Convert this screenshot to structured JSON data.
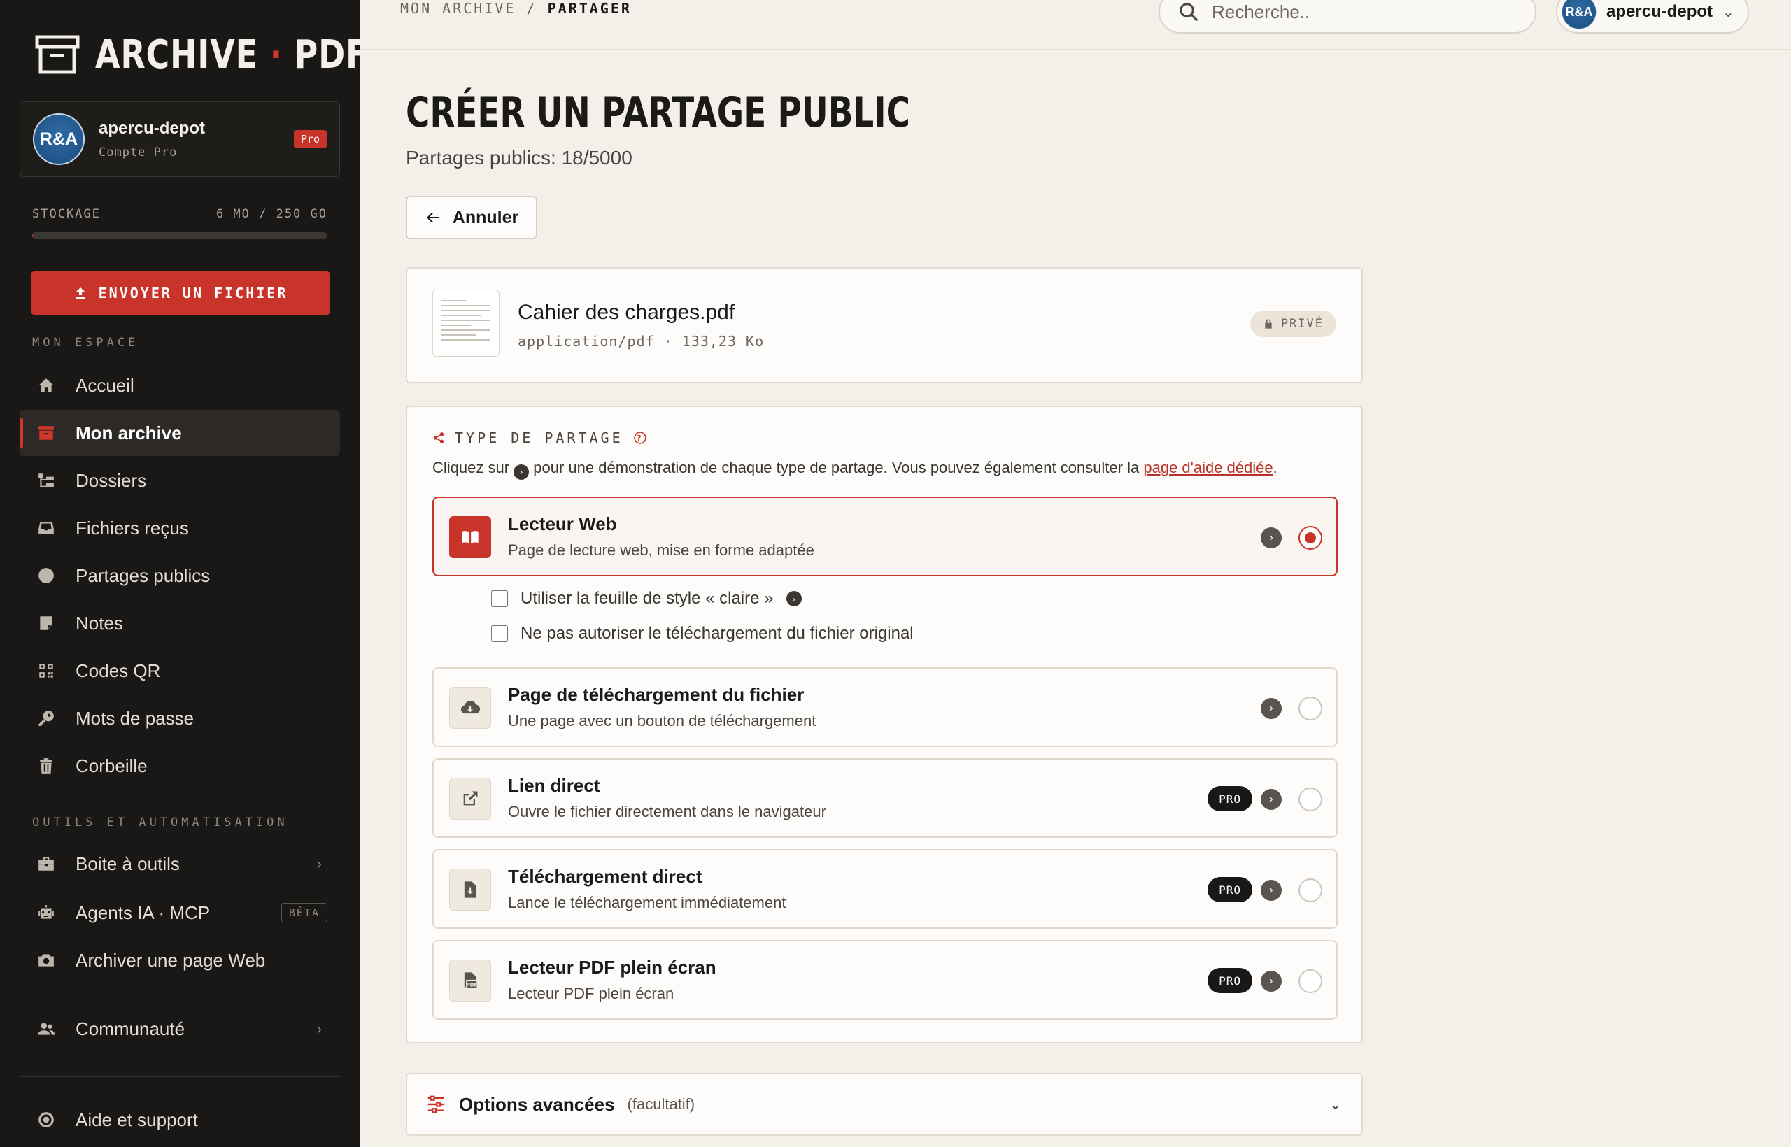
{
  "app": {
    "logo_part1": "ARCHIVE",
    "logo_part2": "PDF"
  },
  "account": {
    "avatar_text": "R&A",
    "name": "apercu-depot",
    "type": "Compte Pro",
    "badge": "Pro"
  },
  "storage": {
    "label": "STOCKAGE",
    "value": "6 MO / 250 GO",
    "used_fraction": 2.4e-05
  },
  "upload": {
    "label": "ENVOYER UN FICHIER"
  },
  "sidebar": {
    "section1": "MON ESPACE",
    "items": [
      {
        "label": "Accueil",
        "icon": "home-icon"
      },
      {
        "label": "Mon archive",
        "icon": "archive-icon",
        "active": true
      },
      {
        "label": "Dossiers",
        "icon": "folders-icon"
      },
      {
        "label": "Fichiers reçus",
        "icon": "inbox-icon"
      },
      {
        "label": "Partages publics",
        "icon": "globe-icon"
      },
      {
        "label": "Notes",
        "icon": "note-icon"
      },
      {
        "label": "Codes QR",
        "icon": "qr-icon"
      },
      {
        "label": "Mots de passe",
        "icon": "key-icon"
      },
      {
        "label": "Corbeille",
        "icon": "trash-icon"
      }
    ],
    "section2": "OUTILS ET AUTOMATISATION",
    "tools": [
      {
        "label": "Boite à outils",
        "icon": "toolbox-icon"
      },
      {
        "label": "Agents IA · MCP",
        "icon": "robot-icon",
        "badge": "BÊTA"
      },
      {
        "label": "Archiver une page Web",
        "icon": "camera-icon"
      }
    ],
    "community": {
      "label": "Communauté",
      "icon": "users-icon"
    },
    "help": {
      "label": "Aide et support",
      "icon": "lifebuoy-icon"
    }
  },
  "topbar": {
    "breadcrumb_1": "MON ARCHIVE",
    "breadcrumb_sep": "/",
    "breadcrumb_2": "PARTAGER",
    "search_placeholder": "Recherche..",
    "user_name": "apercu-depot",
    "user_avatar": "R&A"
  },
  "main": {
    "title": "CRÉER UN PARTAGE PUBLIC",
    "quota": "Partages publics: 18/5000",
    "cancel": "Annuler"
  },
  "file": {
    "name": "Cahier des charges.pdf",
    "meta": "application/pdf · 133,23 Ko",
    "visibility": "PRIVÉ"
  },
  "share_type": {
    "heading": "TYPE DE PARTAGE",
    "desc_before": "Cliquez sur",
    "desc_after": "pour une démonstration de chaque type de partage. Vous pouvez également consulter la",
    "desc_link": "page d'aide dédiée",
    "desc_end": ".",
    "options": [
      {
        "title": "Lecteur Web",
        "subtitle": "Page de lecture web, mise en forme adaptée",
        "selected": true,
        "pro": false
      },
      {
        "title": "Page de téléchargement du fichier",
        "subtitle": "Une page avec un bouton de téléchargement",
        "selected": false,
        "pro": false
      },
      {
        "title": "Lien direct",
        "subtitle": "Ouvre le fichier directement dans le navigateur",
        "selected": false,
        "pro": true
      },
      {
        "title": "Téléchargement direct",
        "subtitle": "Lance le téléchargement immédiatement",
        "selected": false,
        "pro": true
      },
      {
        "title": "Lecteur PDF plein écran",
        "subtitle": "Lecteur PDF plein écran",
        "selected": false,
        "pro": true
      }
    ],
    "pro_label": "PRO",
    "checkbox_light": "Utiliser la feuille de style « claire »",
    "checkbox_nodl": "Ne pas autoriser le téléchargement du fichier original"
  },
  "advanced": {
    "title": "Options avancées",
    "subtitle": "(facultatif)"
  },
  "colors": {
    "accent": "#c9342a",
    "sidebar_bg": "#1a1816",
    "page_bg": "#f3efe9"
  }
}
